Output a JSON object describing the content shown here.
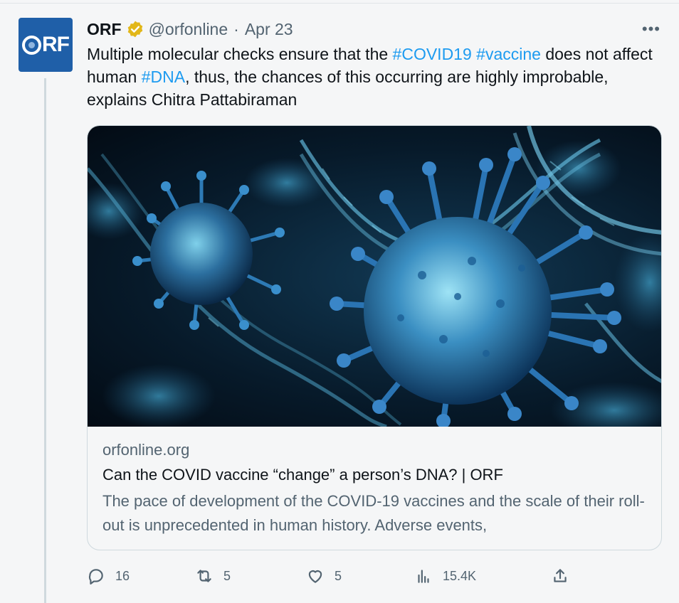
{
  "author": {
    "name": "ORF",
    "handle": "@orfonline",
    "separator": "·",
    "date": "Apr 23",
    "avatar_text": "RF"
  },
  "tweet": {
    "text_parts": [
      {
        "text": "Multiple molecular checks ensure that the ",
        "type": "plain"
      },
      {
        "text": "#COVID19",
        "type": "hashtag"
      },
      {
        "text": " ",
        "type": "plain"
      },
      {
        "text": "#vaccine",
        "type": "hashtag"
      },
      {
        "text": " does not affect human ",
        "type": "plain"
      },
      {
        "text": "#DNA",
        "type": "hashtag"
      },
      {
        "text": ", thus, the chances of this occurring are highly improbable, explains Chitra Pattabiraman",
        "type": "plain"
      }
    ]
  },
  "more_label": "•••",
  "card": {
    "domain": "orfonline.org",
    "title": "Can the COVID vaccine “change” a person’s DNA? | ORF",
    "description": "The pace of development of the COVID-19 vaccines and the scale of their roll-out is unprecedented in human history. Adverse events,"
  },
  "actions": {
    "replies": "16",
    "retweets": "5",
    "likes": "5",
    "views": "15.4K"
  },
  "colors": {
    "accent": "#1d9bf0",
    "verified": "#e2b719",
    "avatar_bg": "#1f5fa8",
    "secondary_text": "#536471"
  }
}
